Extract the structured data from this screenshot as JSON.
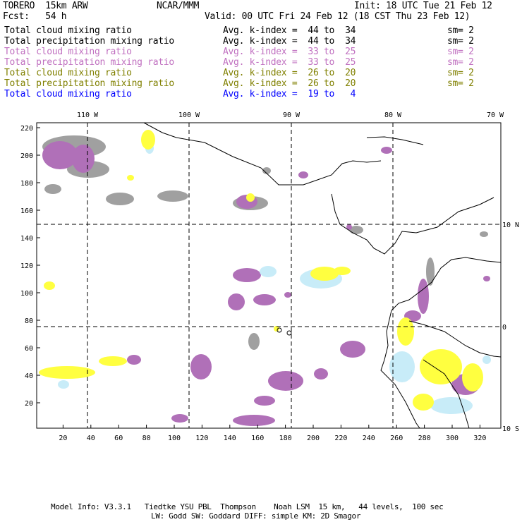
{
  "header": {
    "title": "TORERO  15km ARW",
    "org": "NCAR/MMM",
    "init": "Init: 18 UTC Tue 21 Feb 12",
    "fcst": "Fcst:   54 h",
    "valid": "Valid: 00 UTC Fri 24 Feb 12 (18 CST Thu 23 Feb 12)"
  },
  "legend": [
    {
      "field": "Total cloud mixing ratio",
      "range": "Avg. k-index =  44 to  34",
      "sm": "sm= 2",
      "color": "#000000"
    },
    {
      "field": "Total precipitation mixing ratio",
      "range": "Avg. k-index =  44 to  34",
      "sm": "sm= 2",
      "color": "#000000"
    },
    {
      "field": "Total cloud mixing ratio",
      "range": "Avg. k-index =  33 to  25",
      "sm": "sm= 2",
      "color": "#c070c0"
    },
    {
      "field": "Total precipitation mixing ratio",
      "range": "Avg. k-index =  33 to  25",
      "sm": "sm= 2",
      "color": "#c070c0"
    },
    {
      "field": "Total cloud mixing ratio",
      "range": "Avg. k-index =  26 to  20",
      "sm": "sm= 2",
      "color": "#808000"
    },
    {
      "field": "Total precipitation mixing ratio",
      "range": "Avg. k-index =  26 to  20",
      "sm": "sm= 2",
      "color": "#808000"
    },
    {
      "field": "Total cloud mixing ratio",
      "range": "Avg. k-index =  19 to   4",
      "color": "#0000ff"
    }
  ],
  "map": {
    "lon_labels": [
      "110 W",
      "100 W",
      "90 W",
      "80 W",
      "70 W"
    ],
    "lat_labels": [
      "10 N",
      "0",
      "10 S"
    ],
    "x_ticks": [
      "20",
      "40",
      "60",
      "80",
      "100",
      "120",
      "140",
      "160",
      "180",
      "200",
      "220",
      "240",
      "260",
      "280",
      "300",
      "320"
    ],
    "y_ticks": [
      "20",
      "40",
      "60",
      "80",
      "100",
      "120",
      "140",
      "160",
      "180",
      "200",
      "220"
    ],
    "colors": {
      "gray": "#a0a0a0",
      "purple": "#b070b8",
      "yellow": "#ffff40",
      "lightblue": "#c8ecf8"
    }
  },
  "footer": {
    "line1": "Model Info: V3.3.1   Tiedtke YSU PBL  Thompson    Noah LSM  15 km,   44 levels,  100 sec",
    "line2": "LW: Godd SW: Goddard DIFF: simple KM: 2D Smagor"
  }
}
